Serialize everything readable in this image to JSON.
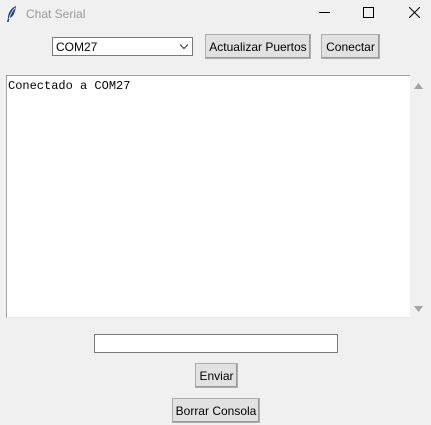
{
  "window": {
    "title": "Chat Serial",
    "icon": "feather-icon",
    "controls": [
      "minimize-icon",
      "maximize-icon",
      "close-icon"
    ]
  },
  "toolbar": {
    "port_select": {
      "selected": "COM27"
    },
    "refresh_label": "Actualizar Puertos",
    "connect_label": "Conectar"
  },
  "console": {
    "text": "Conectado a COM27"
  },
  "message": {
    "value": "",
    "placeholder": ""
  },
  "actions": {
    "send_label": "Enviar",
    "clear_label": "Borrar Consola"
  },
  "colors": {
    "background": "#f0f0f0",
    "button_face": "#e1e1e1",
    "title_text": "#9a9a9a"
  }
}
